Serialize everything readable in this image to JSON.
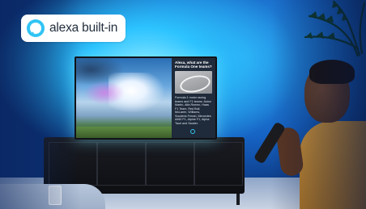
{
  "badge": {
    "label": "alexa built-in",
    "icon": "alexa-logo-icon",
    "icon_color": "#31C4F3"
  },
  "tv_screen": {
    "question": "Alexa, what are the Formula One teams?",
    "answer": "Formula 1 motor racing teams and F1 teams: Aston Martin, Alfa Romeo, Haas F1 Team, Red Bull, McLaren, Williams, Scuderia Ferrari, Mercedes AMG F1, Alpine F1, Alpha Tauri and Sauber."
  },
  "colors": {
    "ambilight": "#2CC3FF",
    "wall": "#1663C4"
  }
}
